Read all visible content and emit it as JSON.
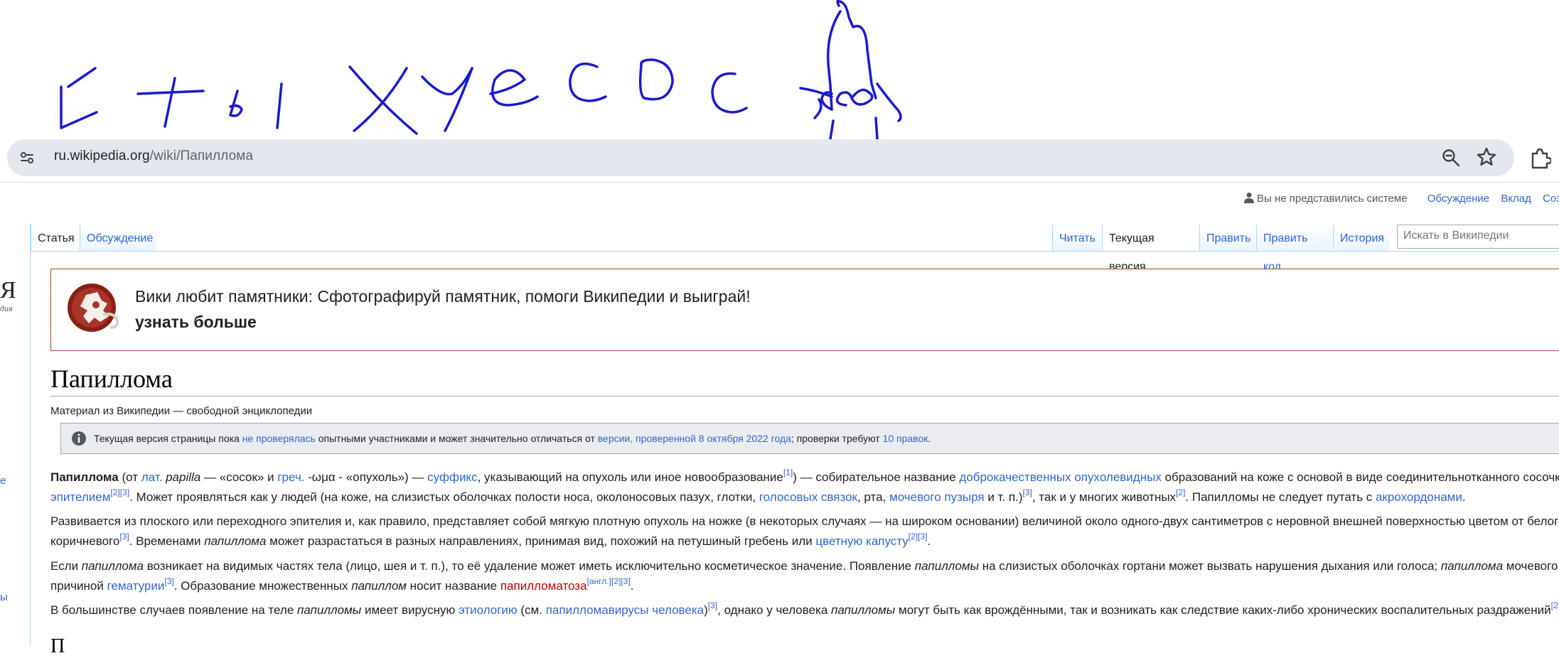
{
  "browser": {
    "url_host": "ru.wikipedia.org",
    "url_path": "/wiki/Папиллома"
  },
  "personal_tools": {
    "anon": "Вы не представились системе",
    "talk": "Обсуждение",
    "contributions": "Вклад",
    "create_account": "Создать"
  },
  "sidebar_fragments": {
    "logo_letter": "Я",
    "logo_sub": "дия",
    "frag1": "е",
    "frag2": "ы"
  },
  "tabs": {
    "article": "Статья",
    "talk": "Обсуждение",
    "read": "Читать",
    "current_version": "Текущая версия",
    "edit": "Править",
    "edit_source": "Править код",
    "history": "История"
  },
  "search": {
    "placeholder": "Искать в Википедии"
  },
  "banner": {
    "title": "Вики любит памятники: Сфотографируй памятник, помоги Википедии и выиграй!",
    "more": "узнать больше"
  },
  "page": {
    "title": "Папиллома",
    "tagline": "Материал из Википедии — свободной энциклопедии"
  },
  "notice": {
    "t1": "Текущая версия страницы пока ",
    "l1": "не проверялась",
    "t2": " опытными участниками и может значительно отличаться от ",
    "l2": "версии, проверенной 8 октября 2022 года",
    "t3": "; проверки требуют ",
    "l3": "10 правок",
    "t4": "."
  },
  "article": {
    "p1": {
      "b": "Папиллома",
      "t1": " (от ",
      "l_lat": "лат.",
      "i_papilla": "papilla",
      "t2": " — «сосок» и ",
      "l_greek": "греч.",
      "t3": " -ωμα - «опухоль») — ",
      "l_suffix": "суффикс",
      "t4": ", указывающий на опухоль или иное новообразование",
      "s1": "[1]",
      "t5": ") — собирательное название ",
      "l_benign": "доброкачественных опухолевидных",
      "t6": " образований на коже с основой в виде соединительнотканного сосочка, п",
      "l_epith": "эпителием",
      "s2": "[2]",
      "s3": "[3]",
      "t7": ". Может проявляться как у людей (на коже, на слизистых оболочках полости носа, околоносовых пазух, глотки, ",
      "l_vocal": "голосовых связок",
      "t8": ", рта, ",
      "l_bladder": "мочевого пузыря",
      "t9": " и т. п.)",
      "s4": "[3]",
      "t10": ", так и у многих животных",
      "s5": "[2]",
      "t11": ". Папилломы не следует путать с ",
      "l_acro": "акрохордонами",
      "t12": "."
    },
    "p2": {
      "t1": "Развивается из плоского или переходного эпителия и, как правило, представляет собой мягкую плотную опухоль на ножке (в некоторых случаях — на широком основании) величиной около одного-двух сантиметров с неровной внешней поверхностью цветом от белого до",
      "t2": "коричневого",
      "s1": "[3]",
      "t3": ". Временами ",
      "i1": "папиллома",
      "t4": " может разрастаться в разных направлениях, принимая вид, похожий на петушиный гребень или ",
      "l_cauli": "цветную капусту",
      "s2": "[2]",
      "s3": "[3]",
      "t5": "."
    },
    "p3": {
      "t1": "Если ",
      "i1": "папиллома",
      "t2": " возникает на видимых частях тела (лицо, шея и т. п.), то её удаление может иметь исключительно косметическое значение. Появление ",
      "i2": "папилломы",
      "t3": " на слизистых оболочках гортани может вызвать нарушения дыхания или голоса; ",
      "i3": "папиллома",
      "t4": " мочевого пузы",
      "t5": "причиной ",
      "l_hemat": "гематурии",
      "s1": "[3]",
      "t6": ". Образование множественных ",
      "i4": "папиллом",
      "t7": " носит название ",
      "l_papillomatosis": "папилломатоза",
      "s_en": "[англ.]",
      "s2": "[2]",
      "s3": "[3]",
      "t8": "."
    },
    "p4": {
      "t1": "В большинстве случаев появление на теле ",
      "i1": "папилломы",
      "t2": " имеет вирусную ",
      "l_etio": "этиологию",
      "t3": " (см. ",
      "l_hpv": "папилломавирусы человека",
      "t4": ")",
      "s1": "[3]",
      "t5": ", однако у человека ",
      "i2": "папилломы",
      "t6": " могут быть как врождёнными, так и возникать как следствие каких-либо хронических воспалительных раздражений",
      "s2": "[2]",
      "t7": "."
    },
    "next_heading_fragment": "П"
  },
  "colors": {
    "link": "#3366cc",
    "redlink": "#ba0000",
    "scribble": "#1a1acd",
    "banner_border": "#a2482c",
    "address_bar": "#e4e8ee"
  },
  "icons": [
    "site-settings-icon",
    "zoom-icon",
    "bookmark-star-icon",
    "extensions-icon",
    "user-icon",
    "info-icon",
    "wiki-loves-monuments-logo"
  ]
}
